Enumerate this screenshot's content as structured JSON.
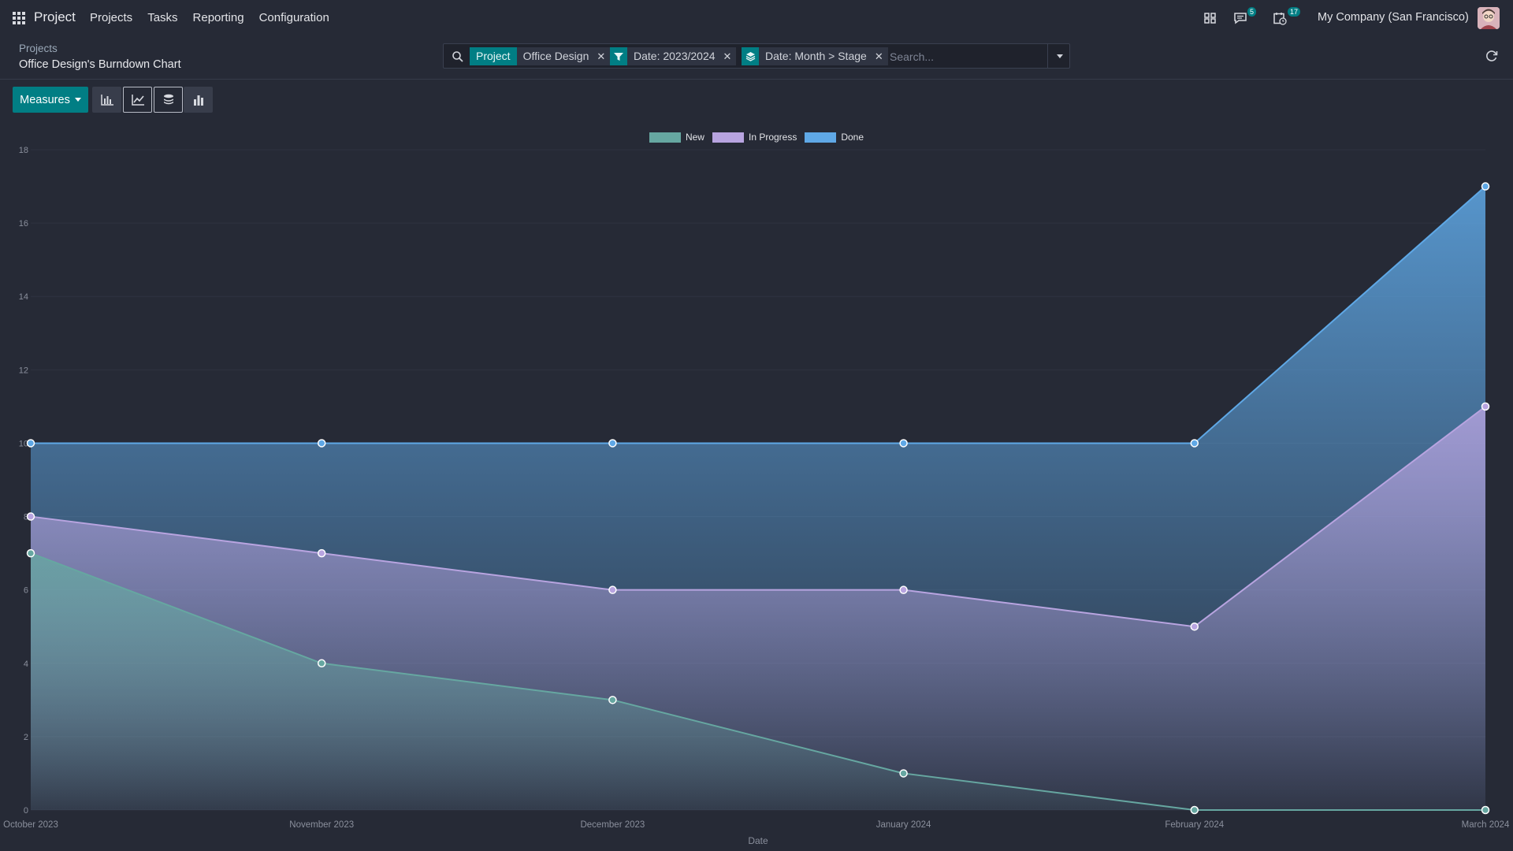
{
  "topbar": {
    "app_name": "Project",
    "menu": [
      "Projects",
      "Tasks",
      "Reporting",
      "Configuration"
    ],
    "messages_count": "5",
    "activities_count": "17",
    "company": "My Company (San Francisco)",
    "icons": [
      "apps-grid-icon",
      "switcher-icon",
      "chat-icon",
      "activity-clock-icon"
    ]
  },
  "breadcrumb": {
    "parent": "Projects",
    "current": "Office Design's Burndown Chart"
  },
  "search": {
    "facets": [
      {
        "label": "Project",
        "value": "Office Design"
      },
      {
        "icon": "filter-icon",
        "value": "Date: 2023/2024"
      },
      {
        "icon": "layers-icon",
        "value": "Date: Month > Stage"
      }
    ],
    "placeholder": "Search..."
  },
  "toolbar": {
    "measures_label": "Measures",
    "views": [
      "bar-chart-icon",
      "line-chart-icon",
      "stacked-icon",
      "column-icon"
    ]
  },
  "colors": {
    "accent": "#017e84",
    "new": "#66a7a1",
    "in_progress": "#b8a4e0",
    "done": "#5fa8e6"
  },
  "chart_data": {
    "type": "area",
    "stacked": true,
    "x": [
      "October 2023",
      "November 2023",
      "December 2023",
      "January 2024",
      "February 2024",
      "March 2024"
    ],
    "series": [
      {
        "name": "New",
        "values": [
          7,
          4,
          3,
          1,
          0,
          0
        ]
      },
      {
        "name": "In Progress",
        "values": [
          1,
          3,
          3,
          5,
          5,
          11
        ]
      },
      {
        "name": "Done",
        "values": [
          2,
          3,
          4,
          4,
          5,
          6
        ]
      }
    ],
    "xlabel": "Date",
    "ylabel": "",
    "ylim": [
      0,
      18
    ],
    "yticks": [
      0,
      2,
      4,
      6,
      8,
      10,
      12,
      14,
      16,
      18
    ],
    "legend": "top-center",
    "grid": true
  }
}
